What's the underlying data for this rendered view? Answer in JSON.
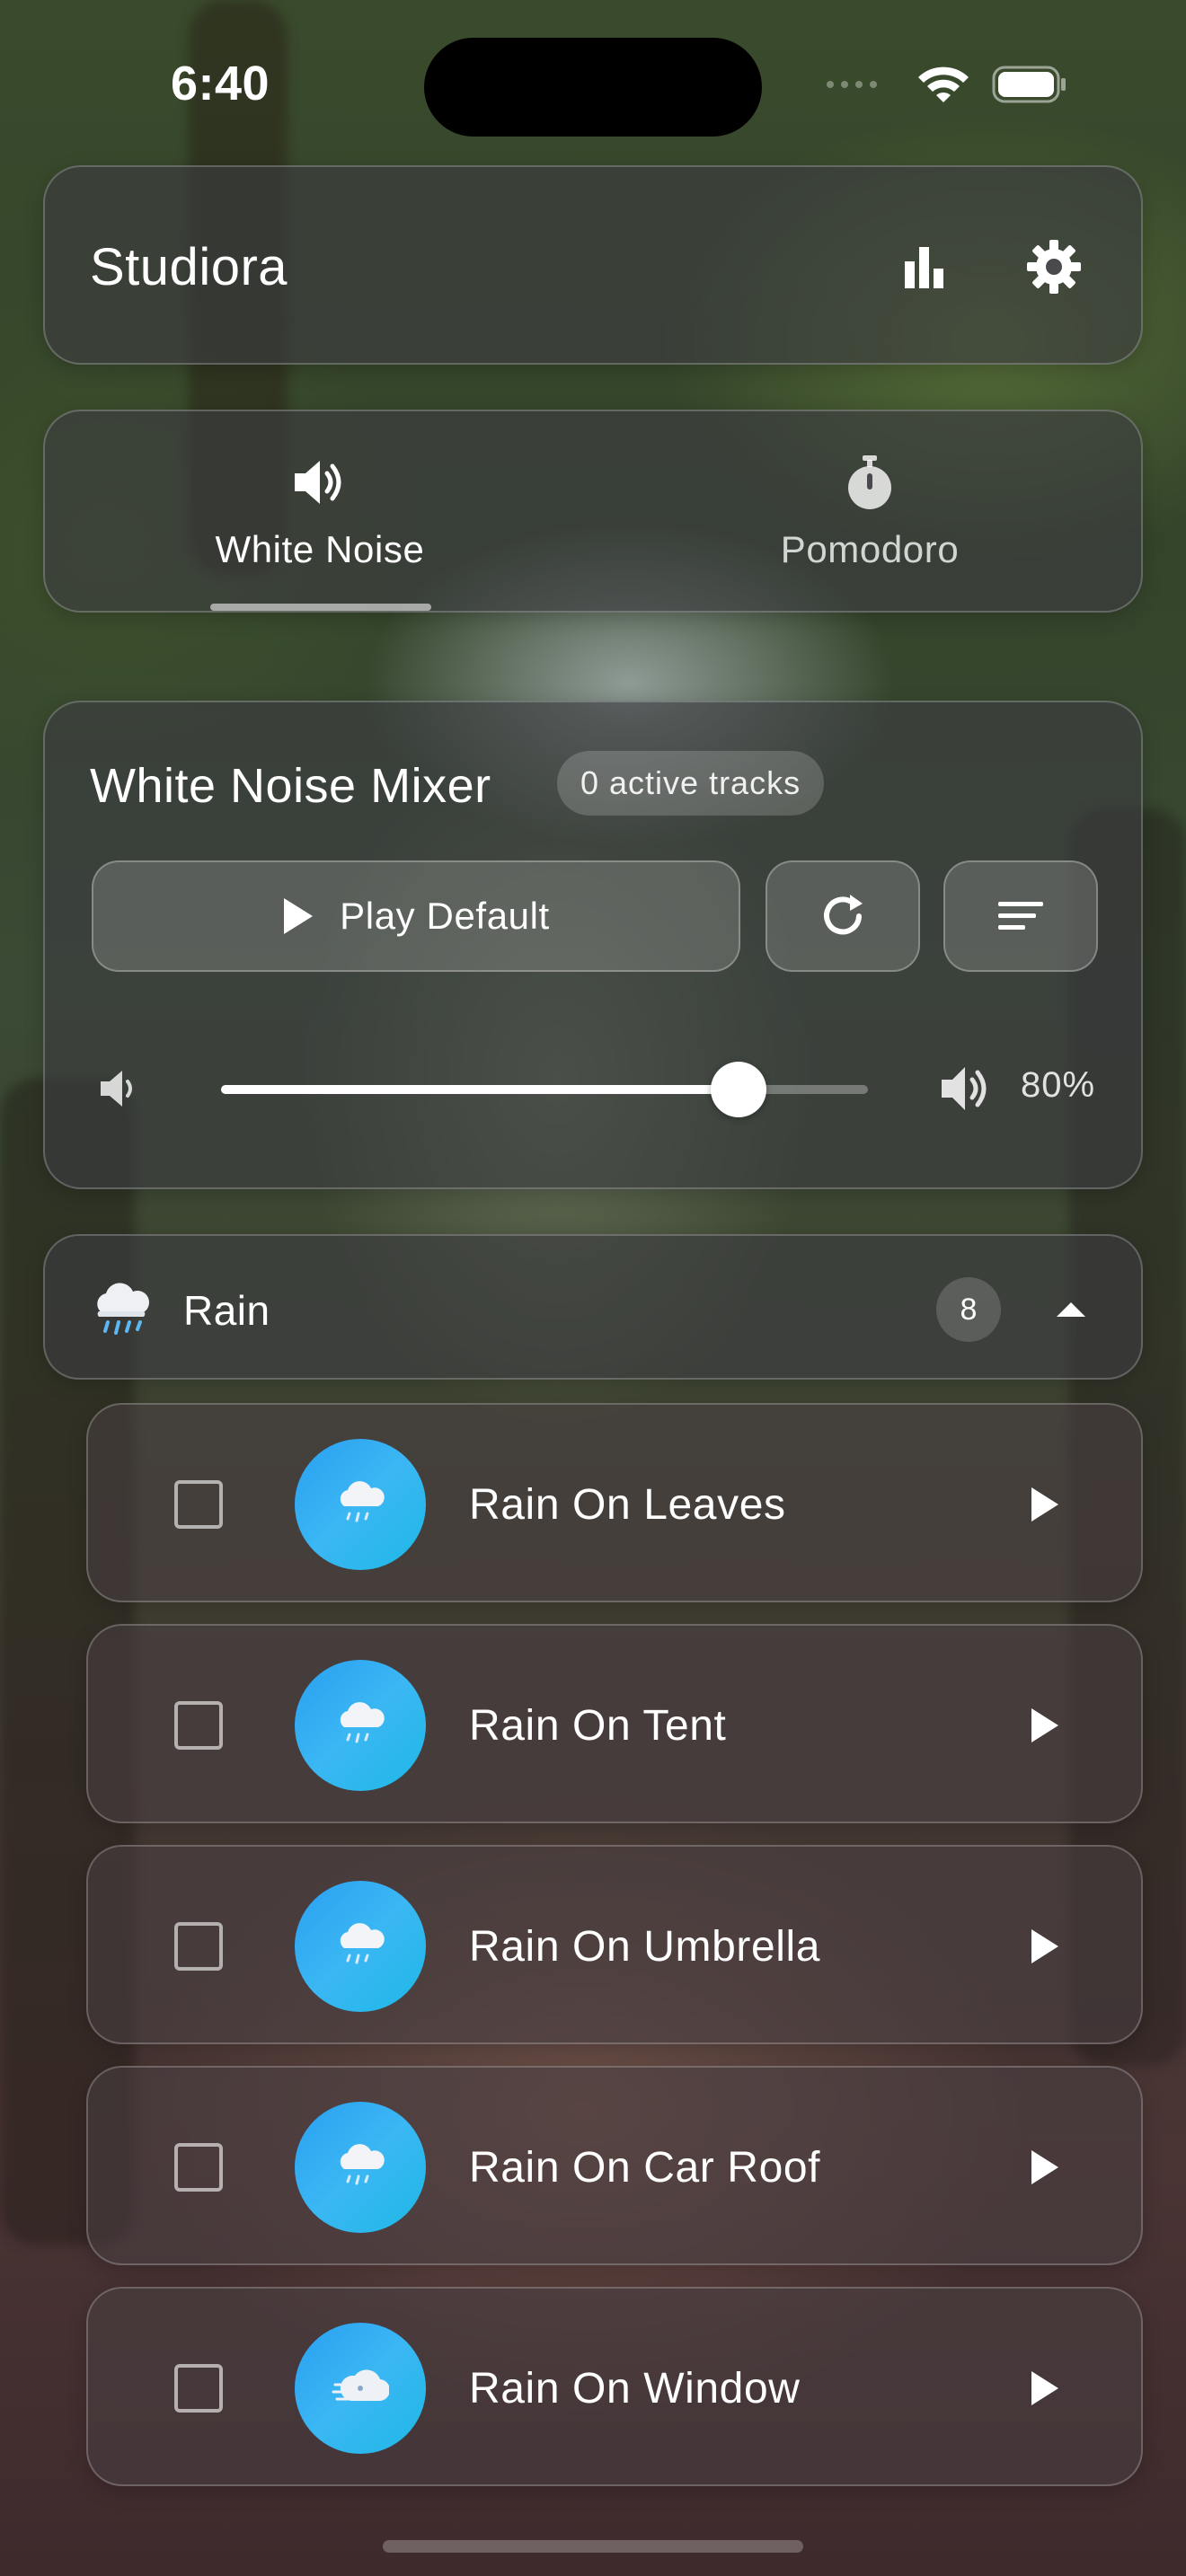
{
  "status_bar": {
    "time": "6:40",
    "icons": [
      "signal-icon",
      "wifi-icon",
      "battery-icon"
    ]
  },
  "header": {
    "title": "Studiora",
    "buttons": [
      {
        "icon": "bar-chart-icon",
        "label": "statistics"
      },
      {
        "icon": "gear-icon",
        "label": "settings"
      }
    ]
  },
  "tabs": [
    {
      "label": "White Noise",
      "icon": "speaker-icon",
      "selected": true
    },
    {
      "label": "Pomodoro",
      "icon": "stopwatch-icon",
      "selected": false
    }
  ],
  "mixer": {
    "title": "White Noise Mixer",
    "active_tracks_badge": "0 active tracks",
    "play_default_label": "Play Default",
    "reset_icon": "refresh-icon",
    "sort_icon": "sort-lines-icon",
    "volume": {
      "value_fraction": 0.8,
      "display": "80%",
      "low_icon": "volume-low-icon",
      "high_icon": "volume-high-icon"
    }
  },
  "category": {
    "label": "Rain",
    "emoji": "rain-cloud-emoji",
    "count": "8",
    "expanded": true,
    "chevron_icon": "chevron-up-icon"
  },
  "tracks": [
    {
      "name": "Rain On Leaves",
      "checked": false,
      "icon": "rain-cloud-icon"
    },
    {
      "name": "Rain On Tent",
      "checked": false,
      "icon": "rain-cloud-icon"
    },
    {
      "name": "Rain On Umbrella",
      "checked": false,
      "icon": "rain-cloud-icon"
    },
    {
      "name": "Rain On Car Roof",
      "checked": false,
      "icon": "rain-cloud-icon"
    },
    {
      "name": "Rain On Window",
      "checked": false,
      "icon": "wind-face-icon"
    }
  ],
  "colors": {
    "accent_avatar": "#2a9ff2",
    "glass_panel": "#3c3c40",
    "text": "#ffffff"
  }
}
